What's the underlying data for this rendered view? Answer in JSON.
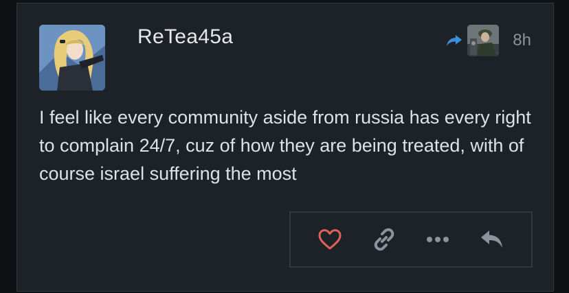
{
  "post": {
    "username": "ReTea45a",
    "time": "8h",
    "body": "I feel like every community aside from russia has every right to complain 24/7, cuz of how they are being treated, with of course israel suffering the most"
  },
  "icons": {
    "like": "heart-icon",
    "link": "link-icon",
    "more": "more-icon",
    "reply": "reply-icon",
    "share": "share-arrow-icon"
  },
  "colors": {
    "like": "#e2625a",
    "icon": "#8b949c",
    "share_accent": "#3d8de0"
  }
}
